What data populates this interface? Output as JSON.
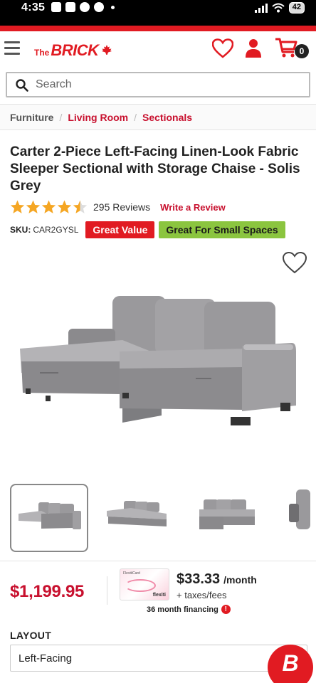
{
  "status_bar": {
    "time": "4:35",
    "battery": "42"
  },
  "header": {
    "logo_the": "The",
    "logo_brick": "BRICK",
    "cart_count": "0",
    "icons": [
      "menu-icon",
      "maple-leaf-icon",
      "heart-icon",
      "user-icon",
      "cart-icon"
    ]
  },
  "search": {
    "placeholder": "Search"
  },
  "breadcrumb": [
    "Furniture",
    "Living Room",
    "Sectionals"
  ],
  "product": {
    "title": "Carter 2-Piece Left-Facing Linen-Look Fabric Sleeper Sectional with Storage Chaise - Solis Grey",
    "rating": 4.5,
    "reviews": "295 Reviews",
    "write_review": "Write a Review",
    "sku_label": "SKU:",
    "sku": "CAR2GYSL",
    "badges": [
      "Great Value",
      "Great For Small Spaces"
    ],
    "price": "$1,199.95",
    "monthly": "$33.33",
    "monthly_unit": "/month",
    "taxes": "+ taxes/fees",
    "financing": "36 month financing",
    "financing_card": {
      "label": "FlexitiCard",
      "brand": "flexiti"
    },
    "layout_label": "LAYOUT",
    "layout_value": "Left-Facing"
  },
  "colors": {
    "brand_red": "#e11b22",
    "link_red": "#c8102e",
    "badge_green": "#8bc53f",
    "star_gold": "#f5a623"
  },
  "chat": {
    "letter": "B"
  }
}
